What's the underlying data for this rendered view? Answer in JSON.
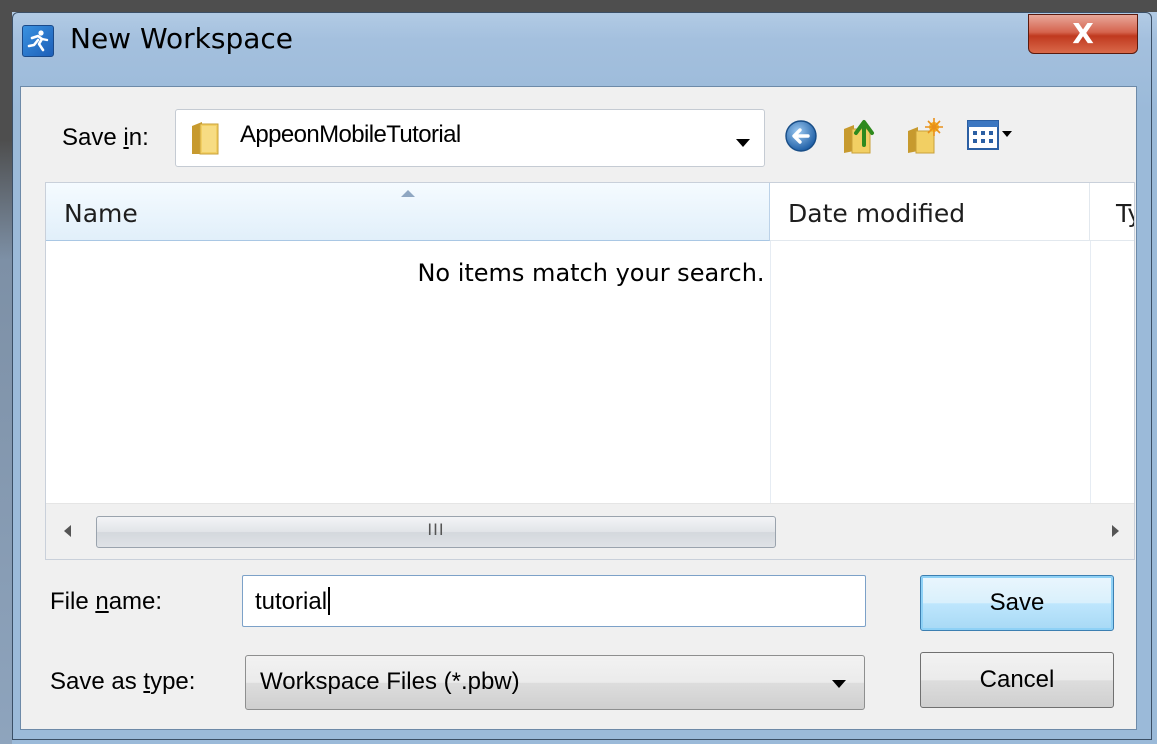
{
  "window": {
    "title": "New Workspace",
    "close_glyph": "X"
  },
  "save_in": {
    "label_pre": "Save ",
    "label_accel": "i",
    "label_post": "n:",
    "value": "AppeonMobileTutorial"
  },
  "toolbar": {
    "back_icon": "back-arrow-icon",
    "up_icon": "up-folder-icon",
    "new_folder_icon": "new-folder-icon",
    "view_icon": "view-menu-icon"
  },
  "file_list": {
    "columns": [
      "Name",
      "Date modified",
      "Ty"
    ],
    "empty_message": "No items match your search.",
    "scroll_thumb_glyph": "III"
  },
  "file_name": {
    "label_pre": "File ",
    "label_accel": "n",
    "label_post": "ame:",
    "value": "tutorial"
  },
  "save_as_type": {
    "label_pre": "Save as ",
    "label_accel": "t",
    "label_post": "ype:",
    "value": "Workspace Files (*.pbw)"
  },
  "buttons": {
    "save": "Save",
    "cancel": "Cancel"
  },
  "colors": {
    "close_button": "#c0391f",
    "selection_border": "#7ca1c8",
    "header_accent": "#e1effa"
  }
}
